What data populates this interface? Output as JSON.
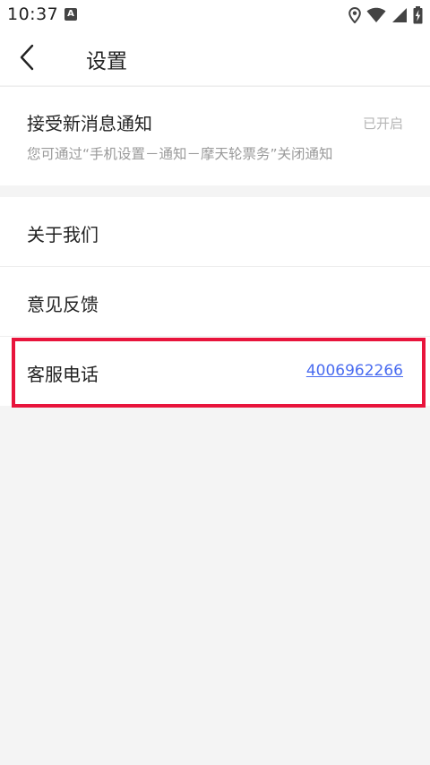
{
  "status_bar": {
    "time": "10:37",
    "notification_icon": "a-icon",
    "right_icons": [
      "location-icon",
      "wifi-icon",
      "signal-icon",
      "battery-charging-icon"
    ]
  },
  "app_bar": {
    "back_icon": "chevron-left-icon",
    "title": "设置"
  },
  "notifications": {
    "title": "接受新消息通知",
    "status": "已开启",
    "description": "您可通过“手机设置－通知－摩天轮票务”关闭通知"
  },
  "menu": {
    "items": [
      {
        "label": "关于我们"
      },
      {
        "label": "意见反馈"
      },
      {
        "label": "客服电话",
        "value": "4006962266"
      }
    ]
  },
  "colors": {
    "link": "#4a6cf0",
    "highlight": "#e8143c",
    "background": "#f4f4f4"
  }
}
